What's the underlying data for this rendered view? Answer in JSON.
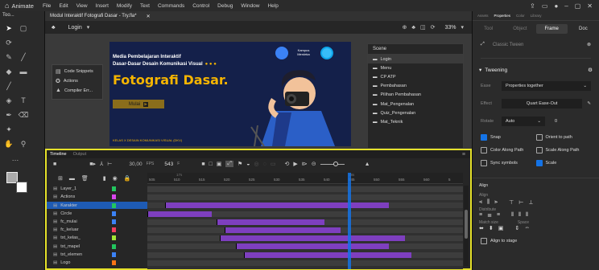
{
  "app": {
    "name": "Animate"
  },
  "menu": [
    "File",
    "Edit",
    "View",
    "Insert",
    "Modify",
    "Text",
    "Commands",
    "Control",
    "Debug",
    "Window",
    "Help"
  ],
  "toolbar": {
    "tools_label": "Too..."
  },
  "document": {
    "tab_title": "Modul Interaktif Fotografi Dasar - Try.fla*"
  },
  "scene": {
    "name": "Login",
    "zoom": "33%"
  },
  "artboard": {
    "subtitle_line1": "Media Pembelajaran Interaktif",
    "subtitle_line2": "Dasar-Dasar Desain Komunikasi Visual",
    "title": "Fotografi Dasar.",
    "button": "Mulai",
    "footer": "KELAS X DESAIN KOMUNIKASI VISUAL (DKV)",
    "logo_text": "Kampus Merdeka"
  },
  "stage_panel": {
    "items": [
      "Code Snippets",
      "Actions",
      "Compiler Err..."
    ]
  },
  "scene_panel": {
    "header": "Scene",
    "items": [
      "Login",
      "Menu",
      "CP ATP",
      "Pembahasan",
      "Pilihan Pembahasan",
      "Mat_Pengenalan",
      "Quiz_Pengenalan",
      "Mat_Teknik"
    ]
  },
  "timeline": {
    "tabs": [
      "Timeline",
      "Output"
    ],
    "fps": "30,00",
    "fps_unit": "FPS",
    "frame": "543",
    "frame_unit": "F",
    "ruler": [
      "505",
      "510",
      "515",
      "520",
      "525",
      "530",
      "535",
      "540",
      "545",
      "550",
      "555",
      "560",
      "5"
    ],
    "ruler_times": [
      "17s",
      "18s"
    ],
    "layers": [
      {
        "name": "Layer_1",
        "color": "#22c55e"
      },
      {
        "name": "Actions",
        "color": "#d946ef"
      },
      {
        "name": "Karakter",
        "color": "#22c55e",
        "selected": true
      },
      {
        "name": "Circle",
        "color": "#3b82f6"
      },
      {
        "name": "fc_mulai",
        "color": "#3b82f6"
      },
      {
        "name": "fc_keluar",
        "color": "#f43f5e"
      },
      {
        "name": "txt_kelas_",
        "color": "#a3e635"
      },
      {
        "name": "txt_mapel",
        "color": "#22c55e"
      },
      {
        "name": "txt_elemen",
        "color": "#3b82f6"
      },
      {
        "name": "Logo",
        "color": "#f97316"
      }
    ]
  },
  "properties": {
    "top_tabs": [
      "Assets",
      "Properties",
      "Color",
      "Library"
    ],
    "sub_tabs": [
      "Tool",
      "Object",
      "Frame",
      "Doc"
    ],
    "tween_label": "Classic Tween",
    "tweening_header": "Tweening",
    "ease_label": "Ease",
    "ease_value": "Properties together",
    "effect_label": "Effect",
    "effect_value": "Quart Ease-Out",
    "rotate_label": "Rotate",
    "rotate_value": "Auto",
    "rotate_count": "0",
    "checks": [
      {
        "label": "Snap",
        "on": true
      },
      {
        "label": "Orient to path",
        "on": false
      },
      {
        "label": "Color Along Path",
        "on": false
      },
      {
        "label": "Scale Along Path",
        "on": false
      },
      {
        "label": "Sync symbols",
        "on": false
      },
      {
        "label": "Scale",
        "on": true
      }
    ],
    "align_header": "Align",
    "align_label": "Align",
    "distribute_label": "Distribute",
    "match_size_label": "Match size",
    "space_label": "Space",
    "align_to_stage": "Align to stage"
  },
  "colors": {
    "accent": "#1473e6",
    "highlight": "#e5e12a",
    "tween": "#7e3fbf",
    "artboard": "#14204a",
    "title_yellow": "#f5b400"
  }
}
